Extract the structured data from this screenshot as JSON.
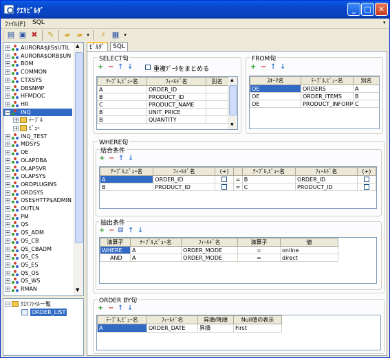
{
  "window": {
    "title": "ｸｴﾘﾋﾞﾙﾀﾞ",
    "btn_min": "_",
    "btn_max": "□",
    "btn_close": "✕"
  },
  "menu": {
    "file": "ﾌｧｲﾙ(F)",
    "sql": "SQL"
  },
  "tree": {
    "items": [
      {
        "label": "AURORA$JIS$UTIL",
        "pm": "+"
      },
      {
        "label": "AURORA$ORB$UN",
        "pm": "+"
      },
      {
        "label": "BOM",
        "pm": "+"
      },
      {
        "label": "COMMON",
        "pm": "+"
      },
      {
        "label": "CTXSYS",
        "pm": "+"
      },
      {
        "label": "DBSNMP",
        "pm": "+"
      },
      {
        "label": "HFMDOC",
        "pm": "+"
      },
      {
        "label": "HR",
        "pm": "+"
      },
      {
        "label": "INQ",
        "pm": "−",
        "selected": true
      },
      {
        "label": "ﾃｰﾌﾞﾙ",
        "pm": "+",
        "child": true
      },
      {
        "label": "ﾋﾞｭｰ",
        "pm": "+",
        "child": true
      },
      {
        "label": "INQ_TEST",
        "pm": "+"
      },
      {
        "label": "MDSYS",
        "pm": "+"
      },
      {
        "label": "OE",
        "pm": "+"
      },
      {
        "label": "OLAPDBA",
        "pm": "+"
      },
      {
        "label": "OLAPSVR",
        "pm": "+"
      },
      {
        "label": "OLAPSYS",
        "pm": "+"
      },
      {
        "label": "ORDPLUGINS",
        "pm": "+"
      },
      {
        "label": "ORDSYS",
        "pm": "+"
      },
      {
        "label": "OSE$HTTP$ADMIN",
        "pm": "+"
      },
      {
        "label": "OUTLN",
        "pm": "+"
      },
      {
        "label": "PM",
        "pm": "+"
      },
      {
        "label": "QS",
        "pm": "+"
      },
      {
        "label": "QS_ADM",
        "pm": "+"
      },
      {
        "label": "QS_CB",
        "pm": "+"
      },
      {
        "label": "QS_CBADM",
        "pm": "+"
      },
      {
        "label": "QS_CS",
        "pm": "+"
      },
      {
        "label": "QS_ES",
        "pm": "+"
      },
      {
        "label": "QS_OS",
        "pm": "+"
      },
      {
        "label": "QS_WS",
        "pm": "+"
      },
      {
        "label": "RMAN",
        "pm": "+"
      }
    ]
  },
  "query_files": {
    "root": "ｸｴﾘﾌｧｲﾙ一覧",
    "item": "ORDER_LIST"
  },
  "tabs": {
    "builder": "ﾋﾞﾙﾀﾞ",
    "sql": "SQL"
  },
  "select": {
    "title": "SELECT句",
    "distinct_label": "重複ﾃﾞｰﾀをまとめる",
    "headers": [
      "ﾃｰﾌﾞﾙ,ﾋﾞｭｰ名",
      "ﾌｨｰﾙﾄﾞ名",
      "別名"
    ],
    "rows": [
      [
        "A",
        "ORDER_ID",
        ""
      ],
      [
        "B",
        "PRODUCT_ID",
        ""
      ],
      [
        "C",
        "PRODUCT_NAME",
        ""
      ],
      [
        "B",
        "UNIT_PRICE",
        ""
      ],
      [
        "B",
        "QUANTITY",
        ""
      ]
    ]
  },
  "from": {
    "title": "FROM句",
    "headers": [
      "ｽｷｰﾏ名",
      "ﾃｰﾌﾞﾙ,ﾋﾞｭｰ名",
      "別名"
    ],
    "rows": [
      [
        "OE",
        "ORDERS",
        "A"
      ],
      [
        "OE",
        "ORDER_ITEMS",
        "B"
      ],
      [
        "OE",
        "PRODUCT_INFORM",
        "C"
      ]
    ]
  },
  "where": {
    "title": "WHERE句",
    "join": {
      "title": "結合条件",
      "headers": [
        "ﾃｰﾌﾞﾙ,ﾋﾞｭｰ名",
        "ﾌｨｰﾙﾄﾞ名",
        "(+)",
        "",
        "ﾃｰﾌﾞﾙ,ﾋﾞｭｰ名",
        "ﾌｨｰﾙﾄﾞ名",
        "(+)"
      ],
      "rows": [
        [
          "A",
          "ORDER_ID",
          "",
          "=",
          "B",
          "ORDER_ID",
          ""
        ],
        [
          "B",
          "PRODUCT_ID",
          "",
          "=",
          "C",
          "PRODUCT_ID",
          ""
        ]
      ]
    },
    "extract": {
      "title": "抽出条件",
      "headers": [
        "演算子",
        "ﾃｰﾌﾞﾙ,ﾋﾞｭｰ名",
        "ﾌｨｰﾙﾄﾞ名",
        "演算子",
        "値"
      ],
      "rows": [
        [
          "WHERE",
          "A",
          "ORDER_MODE",
          "=",
          "online"
        ],
        [
          "AND",
          "A",
          "ORDER_MODE",
          "=",
          "direct"
        ]
      ]
    }
  },
  "orderby": {
    "title": "ORDER BY句",
    "headers": [
      "ﾃｰﾌﾞﾙ,ﾋﾞｭｰ名",
      "ﾌｨｰﾙﾄﾞ名",
      "昇順/降順",
      "Null値の表示"
    ],
    "rows": [
      [
        "A",
        "ORDER_DATE",
        "昇順",
        "First"
      ]
    ]
  },
  "icons": {
    "add": "+",
    "remove": "−",
    "up": "↑",
    "down": "↓"
  },
  "colors": {
    "title_bar": "#0a5ce6",
    "selection": "#316ac5",
    "add": "#2a9a2a",
    "remove": "#d03020",
    "arrow": "#3a78d8"
  }
}
